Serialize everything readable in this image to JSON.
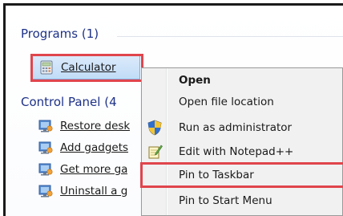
{
  "search_results": {
    "programs_header": "Programs (1)",
    "programs": [
      {
        "label": "Calculator",
        "icon": "calculator-icon"
      }
    ],
    "control_panel_header": "Control Panel (4",
    "control_panel": [
      {
        "label": "Restore desk",
        "icon": "control-panel-icon"
      },
      {
        "label": "Add gadgets",
        "icon": "control-panel-icon"
      },
      {
        "label": "Get more ga",
        "icon": "control-panel-icon"
      },
      {
        "label": "Uninstall a g",
        "icon": "control-panel-icon"
      }
    ]
  },
  "context_menu": {
    "items": [
      {
        "label": "Open",
        "bold": true,
        "icon": ""
      },
      {
        "label": "Open file location",
        "icon": ""
      },
      {
        "label": "Run as administrator",
        "icon": "uac-shield-icon"
      },
      {
        "label": "Edit with Notepad++",
        "icon": "notepad-plus-plus-icon"
      },
      {
        "label": "Pin to Taskbar",
        "icon": ""
      },
      {
        "label": "Pin to Start Menu",
        "icon": ""
      }
    ]
  },
  "colors": {
    "highlight_border": "#e0454c",
    "header_text": "#1e3287",
    "selection_fill": "#c1dcf7"
  }
}
